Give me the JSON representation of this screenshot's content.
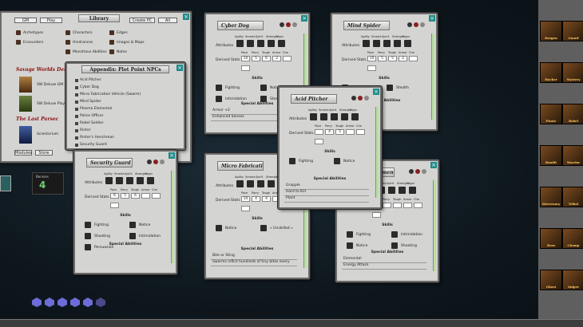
{
  "library": {
    "title": "Library",
    "tabs": [
      "GM",
      "Play"
    ],
    "buttons": [
      "Create PC",
      "All"
    ],
    "items_left": [
      "Archetypes",
      "Encounters",
      "Savage Worlds Deluxe"
    ],
    "items_right": [
      "Characters",
      "Edges",
      "Hindrances",
      "Images & Maps",
      "Monstrous Abilities",
      "Notes"
    ],
    "modules": [
      "Savage Worlds Deluxe",
      "SW Deluxe GM",
      "SW Deluxe Player",
      "The Last Parsec",
      "Scientorium"
    ],
    "bottom_buttons": [
      "Modules",
      "Store"
    ]
  },
  "appendix": {
    "title": "Appendix: Plot Point NPCs",
    "items": [
      "Acid Pitcher",
      "Cyber Dog",
      "Micro Fabrication Vehicle (Swarm)",
      "Mind Spider",
      "Plasma Elemental",
      "Police Officer",
      "Rebel Soldier",
      "Rinter",
      "Rinter's Henchman",
      "Security Guard"
    ]
  },
  "common": {
    "attr_headers": [
      "Agility",
      "Smarts",
      "Spirit",
      "Strength",
      "Vigor"
    ],
    "attributes_label": "Attributes",
    "derived_label": "Derived Stats",
    "derived_headers": [
      "Pace",
      "Parry",
      "Tough",
      "Armor",
      "Cha"
    ],
    "skills_label": "Skills",
    "special_label": "Special Abilities"
  },
  "cyber_dog": {
    "title": "Cyber Dog",
    "derived_values": [
      "10",
      "5",
      "6",
      "2",
      ""
    ],
    "skills": [
      "Fighting",
      "Notice",
      "Intimidation",
      "Stealth"
    ],
    "special": [
      "Armor +2",
      "Enhanced Senses"
    ]
  },
  "mind_spider": {
    "title": "Mind Spider",
    "derived_values": [
      "10",
      "5",
      "5",
      "2",
      ""
    ],
    "skills": [
      "Intimidation",
      "Stealth"
    ]
  },
  "acid_pitcher": {
    "title": "Acid Pitcher",
    "derived_values": [
      "",
      "4",
      "5",
      "",
      ""
    ],
    "skills": [
      "Fighting",
      "Notice"
    ],
    "special": [
      "Grapple",
      "Hard to Kill",
      "Plant"
    ]
  },
  "security_guard": {
    "title": "Security Guard",
    "derived_values": [
      "6",
      "5",
      "6",
      "",
      ""
    ],
    "skills": [
      "Fighting",
      "Notice",
      "Shooting",
      "Intimidation",
      "Persuasion"
    ]
  },
  "micro_fab": {
    "title": "Micro Fabrication Vehicle (Swarm)",
    "derived_values": [
      "10",
      "4",
      "4",
      "",
      ""
    ],
    "skills": [
      "Notice",
      "« Unskilled »"
    ],
    "special": [
      "Bite or Sting",
      "Swarms inflict hundreds of tiny bites every"
    ]
  },
  "plasma": {
    "title": "Plasma Elemental",
    "skills": [
      "Fighting",
      "Intimidation",
      "Notice",
      "Shooting"
    ],
    "special": [
      "Elemental",
      "Energy Attack"
    ]
  },
  "hud": {
    "bennies_label": "Bennies",
    "bennies_value": "4"
  },
  "side_cards": [
    "Dragon",
    "Guard",
    "Hacker",
    "Mystery",
    "Pirate",
    "Rebel",
    "Bandit",
    "Warrior",
    "Mercenary",
    "Tribal",
    "Boss",
    "Champ",
    "Ghost",
    "Sniper"
  ],
  "colors": {
    "accent": "#1e8a8a",
    "scroll": "#b8e0a0",
    "panel": "#d4d4d2"
  }
}
